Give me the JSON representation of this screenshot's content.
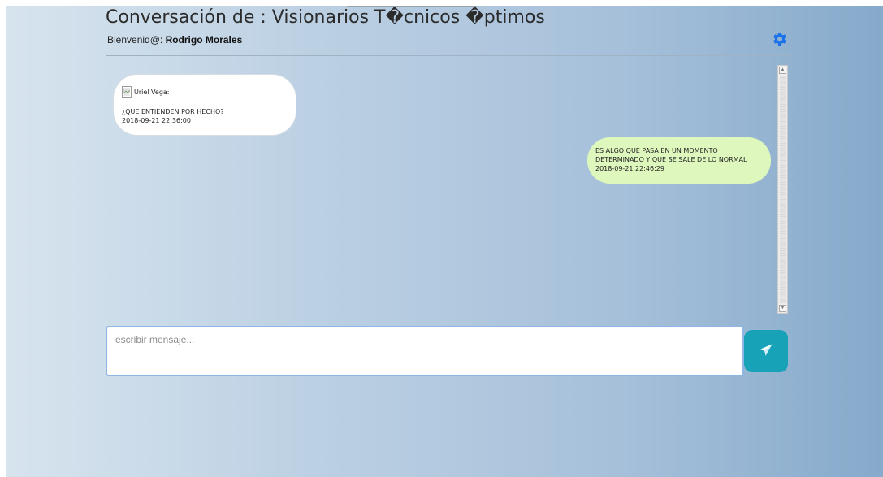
{
  "header": {
    "title": "Conversación de : Visionarios T�cnicos �ptimos",
    "welcome_prefix": "Bienvenid@: ",
    "user_name": "Rodrigo Morales"
  },
  "messages": [
    {
      "sender": "Uriel Vega:",
      "text": "¿QUE ENTIENDEN POR HECHO?",
      "timestamp": "2018-09-21 22:36:00",
      "direction": "incoming"
    },
    {
      "text_line1": "ES ALGO QUE PASA EN UN MOMENTO",
      "text_line2": "DETERMINADO Y QUE SE SALE DE LO NORMAL",
      "timestamp": "2018-09-21 22:46:29",
      "direction": "outgoing"
    }
  ],
  "composer": {
    "placeholder": "escribir mensaje..."
  },
  "icons": {
    "settings": "gear-icon",
    "send": "paper-plane-icon",
    "avatar": "broken-image-icon"
  },
  "colors": {
    "gear": "#1a73e8",
    "send_button": "#17a2b8",
    "incoming_bubble": "#ffffff",
    "outgoing_bubble": "#ddf7bd"
  }
}
